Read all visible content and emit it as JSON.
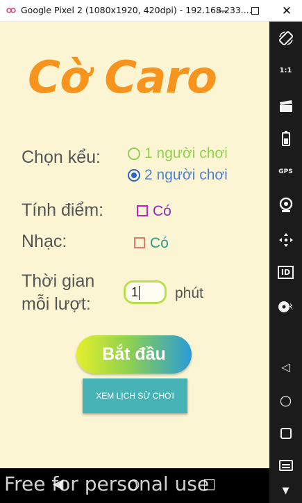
{
  "window": {
    "title": "Google Pixel 2 (1080x1920, 420dpi) - 192.168.233....",
    "min_icon": "minimize-icon",
    "max_icon": "maximize-icon",
    "close_icon": "close-icon"
  },
  "app": {
    "title": "Cờ Caro",
    "mode_label": "Chọn kểu:",
    "mode_options": [
      {
        "label": "1 người chơi",
        "selected": false,
        "color": "#8fd14f"
      },
      {
        "label": "2 người chơi",
        "selected": true,
        "color": "#2b63c7"
      }
    ],
    "score_label": "Tính điểm:",
    "score_checkbox_label": "Có",
    "score_checked": false,
    "music_label": "Nhạc:",
    "music_checkbox_label": "Có",
    "music_checked": false,
    "time_label_line1": "Thời gian",
    "time_label_line2": "mỗi lượt:",
    "time_value": "1",
    "time_unit": "phút",
    "start_button": "Bắt đầu",
    "history_button": "XEM LỊCH SỬ CHƠI"
  },
  "sidebar_icons": [
    "rotate-icon",
    "scale-icon",
    "clapperboard-icon",
    "battery-icon",
    "gps-icon",
    "camera-icon",
    "dpad-icon",
    "id-icon",
    "disk-icon",
    "back-icon",
    "home-icon",
    "overview-icon",
    "menu-icon",
    "chevron-down-icon"
  ],
  "sidebar": {
    "scale": "1:1",
    "gps": "GPS",
    "id": "ID"
  },
  "watermark": "Free for personal use",
  "colors": {
    "background": "#fcf5d3",
    "title": "#f7941d",
    "score_checkbox": "#c51fc5",
    "music_checkbox": "#e6796b",
    "option_text_green": "#8fd14f",
    "option_text_blue": "#4a82d6",
    "checkbox_text_purple": "#8b2fb0",
    "checkbox_text_teal": "#2e9b8b"
  }
}
